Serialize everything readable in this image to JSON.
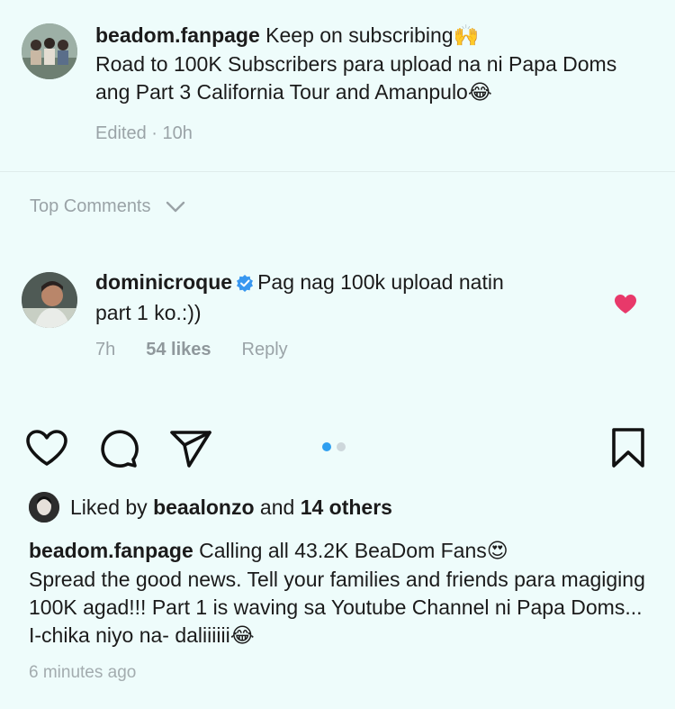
{
  "post": {
    "username": "beadom.fanpage",
    "caption_line1": "Keep on subscribing",
    "caption_emoji1": "🙌",
    "caption_rest": "Road to 100K Subscribers para upload na ni Papa Doms ang Part 3 California Tour and Amanpulo",
    "caption_emoji2": "😂",
    "edited": "Edited",
    "time": "10h"
  },
  "top_comments": {
    "label": "Top Comments"
  },
  "comment": {
    "username": "dominicroque",
    "text_inline": "Pag nag 100k upload natin",
    "text_rest": "part 1 ko.:))",
    "time": "7h",
    "likes": "54 likes",
    "reply": "Reply"
  },
  "liked": {
    "prefix": "Liked by",
    "user": "beaalonzo",
    "and": "and",
    "others": "14 others"
  },
  "caption2": {
    "username": "beadom.fanpage",
    "line1": "Calling all 43.2K BeaDom Fans",
    "emoji1": "😍",
    "rest": "Spread the good news. Tell your families and friends para magiging 100K agad!!! Part 1 is waving sa Youtube Channel ni Papa Doms... I-chika niyo na- daliiiiii",
    "emoji2": "😂",
    "time": "6 minutes ago"
  },
  "colors": {
    "accent": "#2f9ff0",
    "heart": "#e8396a",
    "verified": "#3897f0"
  }
}
